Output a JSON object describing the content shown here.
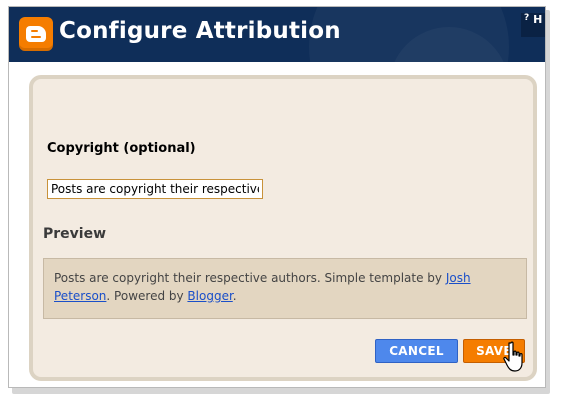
{
  "header": {
    "title": "Configure Attribution",
    "help_label": "H",
    "help_icon": "?"
  },
  "form": {
    "copyright_label": "Copyright (optional)",
    "copyright_value": "Posts are copyright their respective a"
  },
  "preview": {
    "heading": "Preview",
    "text_before": "Posts are copyright their respective authors. Simple template by ",
    "link1": "Josh Peterson",
    "text_middle": ". Powered by ",
    "link2": "Blogger",
    "text_after": "."
  },
  "buttons": {
    "cancel": "CANCEL",
    "save": "SAVE"
  },
  "colors": {
    "titlebar": "#0f2e59",
    "panel_bg": "#f3ebe1",
    "cancel_bg": "#4e88ec",
    "save_bg": "#f57d00",
    "link": "#1a4fc9"
  },
  "icons": {
    "logo": "blogger-logo-icon",
    "cursor": "hand-pointer-icon"
  }
}
